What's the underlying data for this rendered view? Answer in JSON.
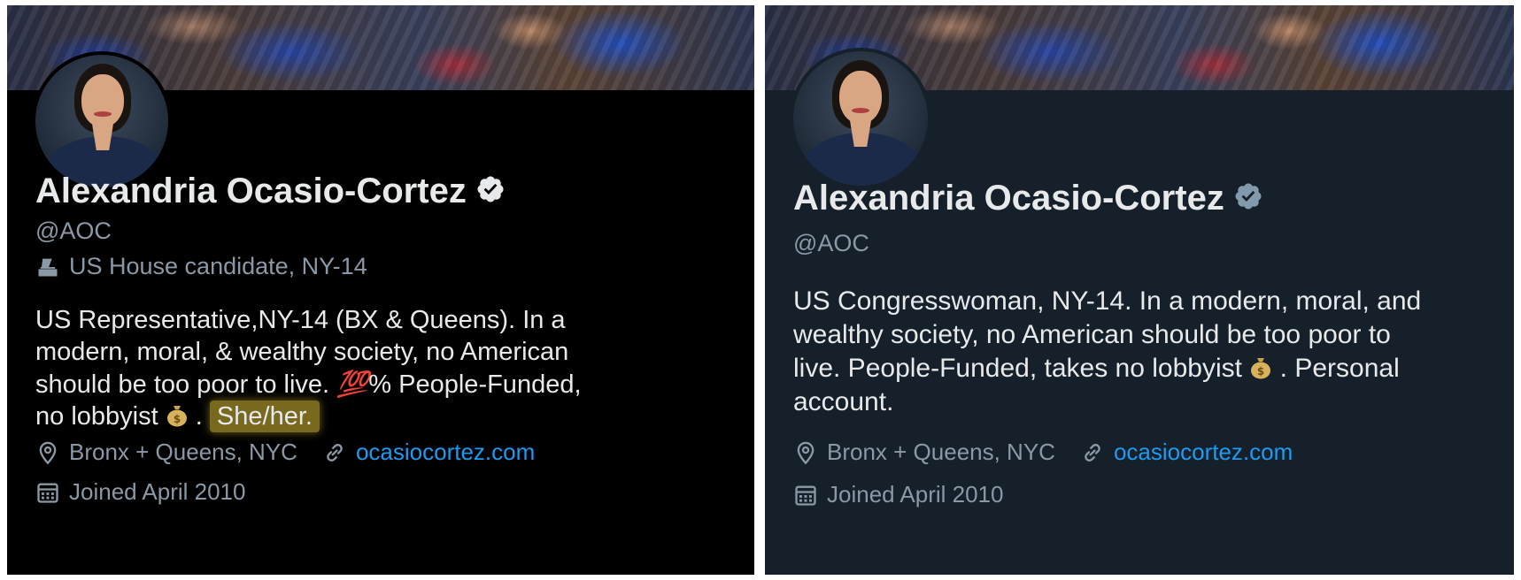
{
  "left": {
    "name": "Alexandria Ocasio-Cortez",
    "handle": "@AOC",
    "candidate_label": "US House candidate, NY-14",
    "bio_line1": "US Representative,NY-14 (BX & Queens). In a",
    "bio_line2": "modern, moral, & wealthy society, no American",
    "bio_line3a": "should be too poor to live.",
    "bio_hundred": "💯",
    "bio_line3b": "% People-Funded,",
    "bio_line4a": "no lobbyist",
    "bio_line4b": ".",
    "pronouns": "She/her.",
    "location": "Bronx + Queens, NYC",
    "website": "ocasiocortez.com",
    "joined": "Joined April 2010"
  },
  "right": {
    "name": "Alexandria Ocasio-Cortez",
    "handle": "@AOC",
    "bio_line1": "US Congresswoman, NY-14. In a modern, moral, and",
    "bio_line2": "wealthy society, no American should be too poor to",
    "bio_line3a": "live. People-Funded, takes no lobbyist",
    "bio_line3b": ". Personal",
    "bio_line4": "account.",
    "location": "Bronx + Queens, NYC",
    "website": "ocasiocortez.com",
    "joined": "Joined April 2010"
  },
  "icons": {
    "verified": "verified-badge-icon",
    "ballot": "ballot-box-icon",
    "location": "location-pin-icon",
    "link": "link-icon",
    "calendar": "calendar-icon",
    "money_bag": "money-bag-emoji"
  },
  "colors": {
    "left_background": "#000000",
    "right_background": "#15202b",
    "link": "#1d9bf0",
    "secondary_text": "#8b98a5",
    "primary_text": "#e7e9ea",
    "highlight": "#a08c28"
  }
}
